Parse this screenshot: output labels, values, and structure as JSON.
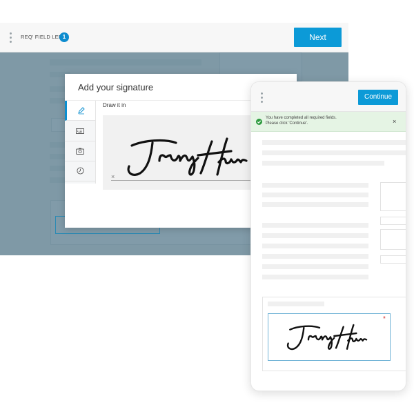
{
  "desktop": {
    "header": {
      "required_label": "REQ' FIELD LEFT",
      "required_count": "1",
      "next_label": "Next"
    }
  },
  "modal": {
    "title": "Add your signature",
    "draw_label": "Draw it in",
    "clear_symbol": "×",
    "tabs": [
      {
        "name": "draw",
        "icon": "pencil-icon",
        "active": true
      },
      {
        "name": "type",
        "icon": "keyboard-icon",
        "active": false
      },
      {
        "name": "upload",
        "icon": "camera-icon",
        "active": false
      },
      {
        "name": "saved",
        "icon": "clock-icon",
        "active": false
      }
    ]
  },
  "mobile": {
    "continue_label": "Continue",
    "notice": {
      "line1": "You have completed all required fields.",
      "line2": "Please click 'Continue'.",
      "close_symbol": "×"
    },
    "required_marker": "*"
  },
  "colors": {
    "accent": "#0c9ad7",
    "badge": "#0d8ccf",
    "overlay": "#487082",
    "success": "#2e9b3f",
    "required": "#d02b2b"
  }
}
